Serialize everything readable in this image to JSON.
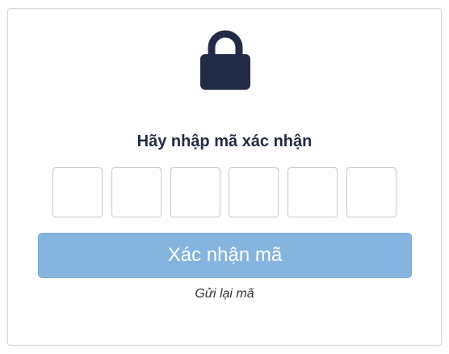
{
  "verification": {
    "icon": "lock-icon",
    "title": "Hãy nhập mã xác nhận",
    "code_length": 6,
    "code_digits": [
      "",
      "",
      "",
      "",
      "",
      ""
    ],
    "confirm_label": "Xác nhận mã",
    "resend_label": "Gửi lại mã"
  },
  "colors": {
    "icon": "#222b45",
    "title": "#222b45",
    "button_bg": "#85b4de",
    "button_text": "#ffffff",
    "box_border": "#c8c8c8"
  }
}
